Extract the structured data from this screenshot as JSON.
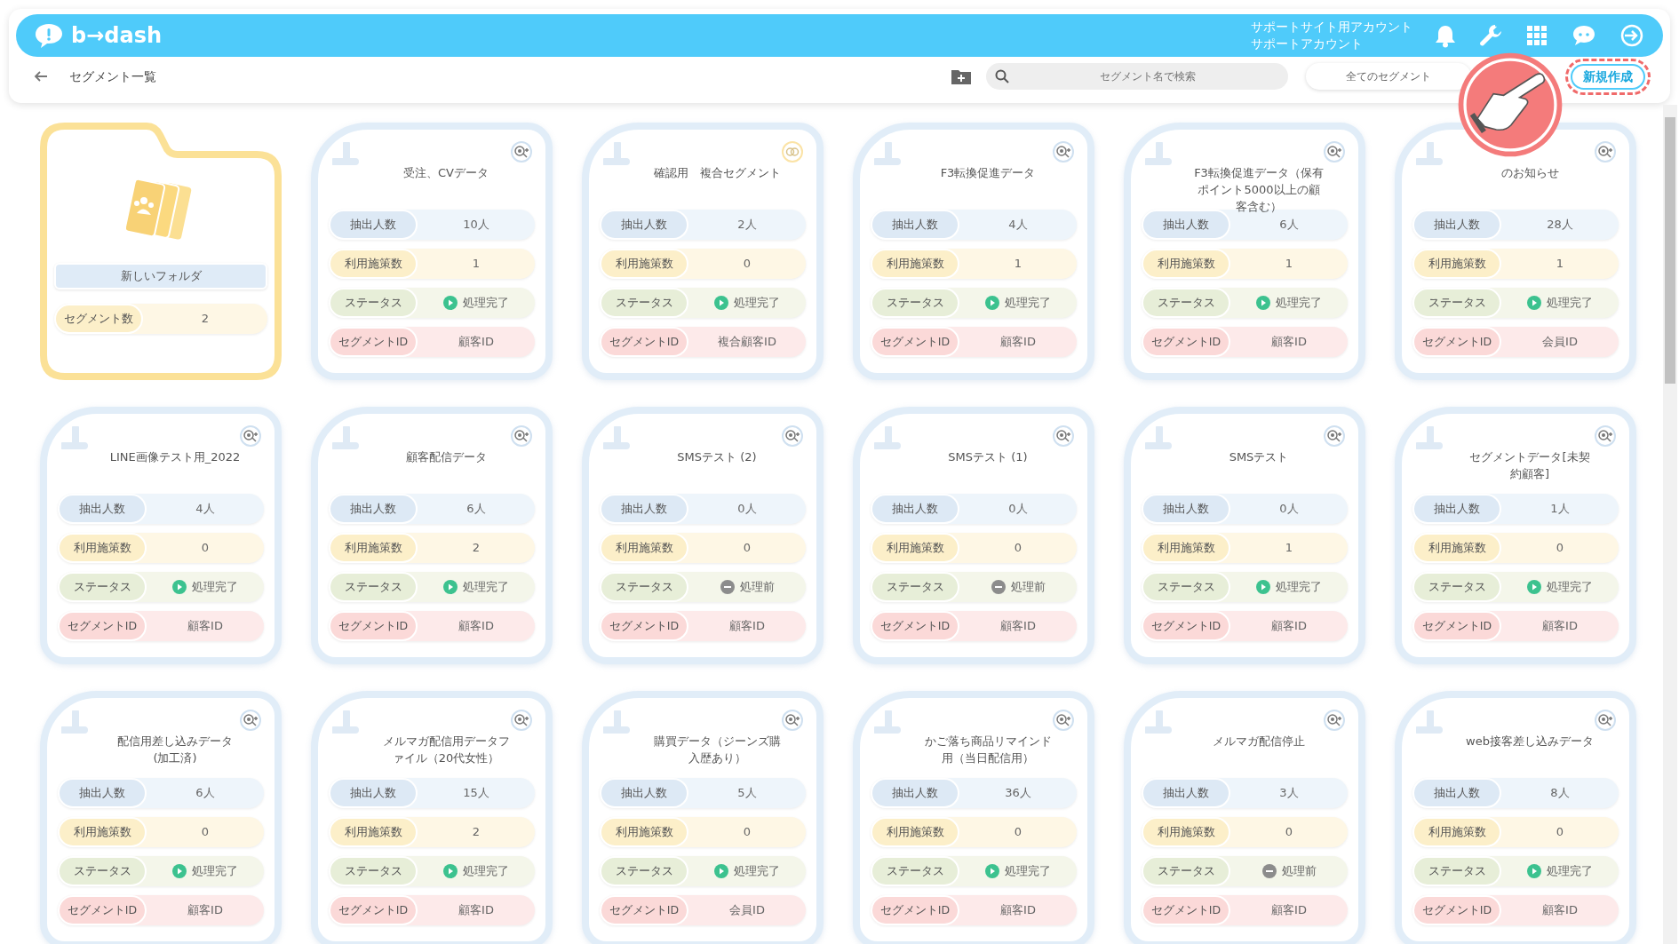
{
  "header": {
    "logo": "b→dash",
    "account": [
      "サポートサイト用アカウント",
      "サポートアカウント"
    ]
  },
  "toolbar": {
    "title": "セグメント一覧",
    "search": {
      "placeholder": "セグメント名で検索"
    },
    "filter": "全てのセグメント",
    "new_button": {
      "label": "新規作成",
      "highlighted": true
    }
  },
  "folders": [
    {
      "name": "新しいフォルダ",
      "count_label": "セグメント数",
      "count": "2"
    }
  ],
  "segments": [
    {
      "title": "受注、CVデータ",
      "composite": false,
      "rows": [
        {
          "kind": "count",
          "label": "抽出人数",
          "value": "10人"
        },
        {
          "kind": "measures",
          "label": "利用施策数",
          "value": "1"
        },
        {
          "kind": "status",
          "label": "ステータス",
          "value": "処理完了",
          "completed": true
        },
        {
          "kind": "id",
          "label": "セグメントID",
          "value": "顧客ID"
        }
      ]
    },
    {
      "title": "確認用　複合セグメント",
      "composite": true,
      "rows": [
        {
          "kind": "count",
          "label": "抽出人数",
          "value": "2人"
        },
        {
          "kind": "measures",
          "label": "利用施策数",
          "value": "0"
        },
        {
          "kind": "status",
          "label": "ステータス",
          "value": "処理完了",
          "completed": true
        },
        {
          "kind": "id",
          "label": "セグメントID",
          "value": "複合顧客ID"
        }
      ]
    },
    {
      "title": "F3転換促進データ",
      "composite": false,
      "rows": [
        {
          "kind": "count",
          "label": "抽出人数",
          "value": "4人"
        },
        {
          "kind": "measures",
          "label": "利用施策数",
          "value": "1"
        },
        {
          "kind": "status",
          "label": "ステータス",
          "value": "処理完了",
          "completed": true
        },
        {
          "kind": "id",
          "label": "セグメントID",
          "value": "顧客ID"
        }
      ]
    },
    {
      "title": "F3転換促進データ（保有ポイント5000以上の顧客含む）",
      "composite": false,
      "rows": [
        {
          "kind": "count",
          "label": "抽出人数",
          "value": "6人"
        },
        {
          "kind": "measures",
          "label": "利用施策数",
          "value": "1"
        },
        {
          "kind": "status",
          "label": "ステータス",
          "value": "処理完了",
          "completed": true
        },
        {
          "kind": "id",
          "label": "セグメントID",
          "value": "顧客ID"
        }
      ]
    },
    {
      "title": "のお知らせ",
      "composite": false,
      "rows": [
        {
          "kind": "count",
          "label": "抽出人数",
          "value": "28人"
        },
        {
          "kind": "measures",
          "label": "利用施策数",
          "value": "1"
        },
        {
          "kind": "status",
          "label": "ステータス",
          "value": "処理完了",
          "completed": true
        },
        {
          "kind": "id",
          "label": "セグメントID",
          "value": "会員ID"
        }
      ]
    },
    {
      "title": "LINE画像テスト用_2022",
      "composite": false,
      "rows": [
        {
          "kind": "count",
          "label": "抽出人数",
          "value": "4人"
        },
        {
          "kind": "measures",
          "label": "利用施策数",
          "value": "0"
        },
        {
          "kind": "status",
          "label": "ステータス",
          "value": "処理完了",
          "completed": true
        },
        {
          "kind": "id",
          "label": "セグメントID",
          "value": "顧客ID"
        }
      ]
    },
    {
      "title": "顧客配信データ",
      "composite": false,
      "rows": [
        {
          "kind": "count",
          "label": "抽出人数",
          "value": "6人"
        },
        {
          "kind": "measures",
          "label": "利用施策数",
          "value": "2"
        },
        {
          "kind": "status",
          "label": "ステータス",
          "value": "処理完了",
          "completed": true
        },
        {
          "kind": "id",
          "label": "セグメントID",
          "value": "顧客ID"
        }
      ]
    },
    {
      "title": "SMSテスト (2)",
      "composite": false,
      "rows": [
        {
          "kind": "count",
          "label": "抽出人数",
          "value": "0人"
        },
        {
          "kind": "measures",
          "label": "利用施策数",
          "value": "0"
        },
        {
          "kind": "status",
          "label": "ステータス",
          "value": "処理前",
          "completed": false
        },
        {
          "kind": "id",
          "label": "セグメントID",
          "value": "顧客ID"
        }
      ]
    },
    {
      "title": "SMSテスト (1)",
      "composite": false,
      "rows": [
        {
          "kind": "count",
          "label": "抽出人数",
          "value": "0人"
        },
        {
          "kind": "measures",
          "label": "利用施策数",
          "value": "0"
        },
        {
          "kind": "status",
          "label": "ステータス",
          "value": "処理前",
          "completed": false
        },
        {
          "kind": "id",
          "label": "セグメントID",
          "value": "顧客ID"
        }
      ]
    },
    {
      "title": "SMSテスト",
      "composite": false,
      "rows": [
        {
          "kind": "count",
          "label": "抽出人数",
          "value": "0人"
        },
        {
          "kind": "measures",
          "label": "利用施策数",
          "value": "1"
        },
        {
          "kind": "status",
          "label": "ステータス",
          "value": "処理完了",
          "completed": true
        },
        {
          "kind": "id",
          "label": "セグメントID",
          "value": "顧客ID"
        }
      ]
    },
    {
      "title": "セグメントデータ[未契約顧客]",
      "composite": false,
      "rows": [
        {
          "kind": "count",
          "label": "抽出人数",
          "value": "1人"
        },
        {
          "kind": "measures",
          "label": "利用施策数",
          "value": "0"
        },
        {
          "kind": "status",
          "label": "ステータス",
          "value": "処理完了",
          "completed": true
        },
        {
          "kind": "id",
          "label": "セグメントID",
          "value": "顧客ID"
        }
      ]
    },
    {
      "title": "配信用差し込みデータ(加工済)",
      "composite": false,
      "rows": [
        {
          "kind": "count",
          "label": "抽出人数",
          "value": "6人"
        },
        {
          "kind": "measures",
          "label": "利用施策数",
          "value": "0"
        },
        {
          "kind": "status",
          "label": "ステータス",
          "value": "処理完了",
          "completed": true
        },
        {
          "kind": "id",
          "label": "セグメントID",
          "value": "顧客ID"
        }
      ]
    },
    {
      "title": "メルマガ配信用データファイル（20代女性）",
      "composite": false,
      "rows": [
        {
          "kind": "count",
          "label": "抽出人数",
          "value": "15人"
        },
        {
          "kind": "measures",
          "label": "利用施策数",
          "value": "2"
        },
        {
          "kind": "status",
          "label": "ステータス",
          "value": "処理完了",
          "completed": true
        },
        {
          "kind": "id",
          "label": "セグメントID",
          "value": "顧客ID"
        }
      ]
    },
    {
      "title": "購買データ（ジーンズ購入歴あり）",
      "composite": false,
      "rows": [
        {
          "kind": "count",
          "label": "抽出人数",
          "value": "5人"
        },
        {
          "kind": "measures",
          "label": "利用施策数",
          "value": "0"
        },
        {
          "kind": "status",
          "label": "ステータス",
          "value": "処理完了",
          "completed": true
        },
        {
          "kind": "id",
          "label": "セグメントID",
          "value": "会員ID"
        }
      ]
    },
    {
      "title": "かご落ち商品リマインド用（当日配信用）",
      "composite": false,
      "rows": [
        {
          "kind": "count",
          "label": "抽出人数",
          "value": "36人"
        },
        {
          "kind": "measures",
          "label": "利用施策数",
          "value": "0"
        },
        {
          "kind": "status",
          "label": "ステータス",
          "value": "処理完了",
          "completed": true
        },
        {
          "kind": "id",
          "label": "セグメントID",
          "value": "顧客ID"
        }
      ]
    },
    {
      "title": "メルマガ配信停止",
      "composite": false,
      "rows": [
        {
          "kind": "count",
          "label": "抽出人数",
          "value": "3人"
        },
        {
          "kind": "measures",
          "label": "利用施策数",
          "value": "0"
        },
        {
          "kind": "status",
          "label": "ステータス",
          "value": "処理前",
          "completed": false
        },
        {
          "kind": "id",
          "label": "セグメントID",
          "value": "顧客ID"
        }
      ]
    },
    {
      "title": "web接客差し込みデータ",
      "composite": false,
      "rows": [
        {
          "kind": "count",
          "label": "抽出人数",
          "value": "8人"
        },
        {
          "kind": "measures",
          "label": "利用施策数",
          "value": "0"
        },
        {
          "kind": "status",
          "label": "ステータス",
          "value": "処理完了",
          "completed": true
        },
        {
          "kind": "id",
          "label": "セグメントID",
          "value": "顧客ID"
        }
      ]
    }
  ]
}
